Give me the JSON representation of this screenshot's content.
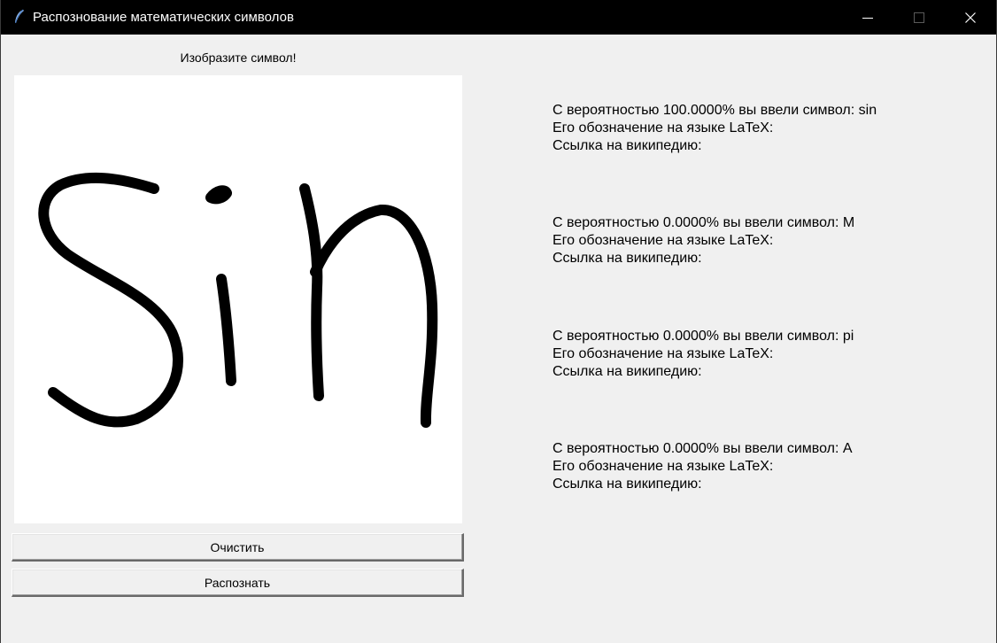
{
  "window": {
    "title": "Распознование математических символов",
    "icon": "feather-icon",
    "controls": [
      "minimize-icon",
      "maximize-icon",
      "close-icon"
    ]
  },
  "canvas": {
    "title": "Изобразите символ!",
    "drawing_content": "handwritten \"sin\" in black ink"
  },
  "buttons": {
    "clear_label": "Очистить",
    "recognize_label": "Распознать"
  },
  "results": [
    {
      "probability_line": "С вероятностью 100.0000% вы ввели символ: sin",
      "latex_line": "Его обозначение на языке LaTeX:",
      "wiki_line": "Ссылка на википедию:"
    },
    {
      "probability_line": "С вероятностью 0.0000% вы ввели символ: M",
      "latex_line": "Его обозначение на языке LaTeX:",
      "wiki_line": "Ссылка на википедию:"
    },
    {
      "probability_line": "С вероятностью 0.0000% вы ввели символ: pi",
      "latex_line": "Его обозначение на языке LaTeX:",
      "wiki_line": "Ссылка на википедию:"
    },
    {
      "probability_line": "С вероятностью 0.0000% вы ввели символ: A",
      "latex_line": "Его обозначение на языке LaTeX:",
      "wiki_line": "Ссылка на википедию:"
    }
  ],
  "colors": {
    "titlebar": "#000000",
    "window_bg": "#f0f0f0",
    "canvas_bg": "#ffffff",
    "ink": "#000000"
  }
}
